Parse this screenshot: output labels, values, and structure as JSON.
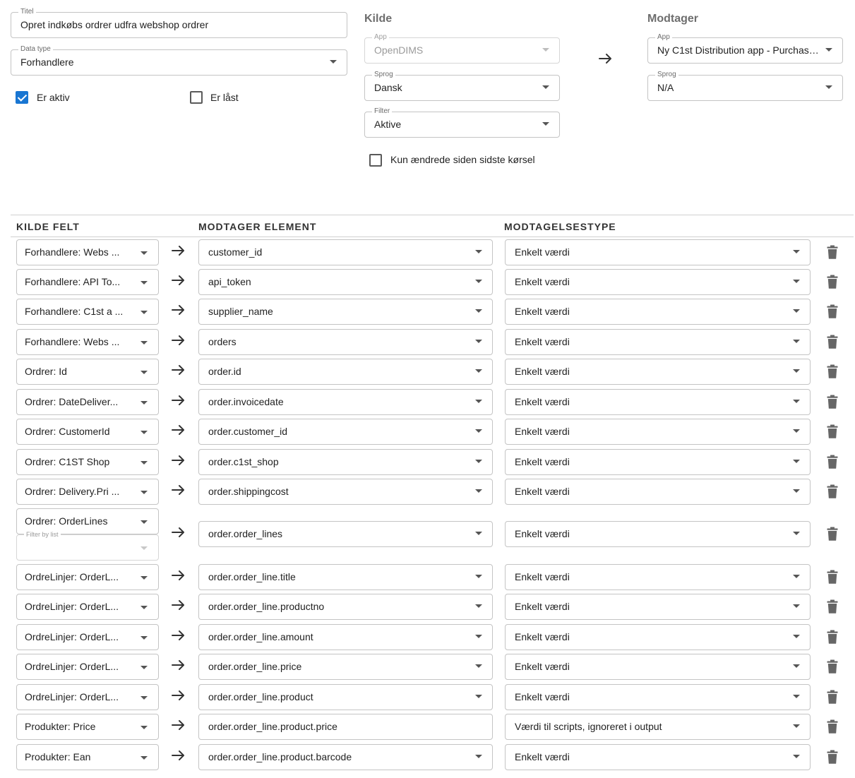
{
  "header": {
    "title_field": {
      "label": "Titel",
      "value": "Opret indkøbs ordrer udfra webshop ordrer"
    },
    "datatype_field": {
      "label": "Data type",
      "value": "Forhandlere"
    },
    "is_active": {
      "label": "Er aktiv",
      "checked": true
    },
    "is_locked": {
      "label": "Er låst",
      "checked": false
    }
  },
  "source": {
    "title": "Kilde",
    "app": {
      "label": "App",
      "value": "OpenDIMS"
    },
    "language": {
      "label": "Sprog",
      "value": "Dansk"
    },
    "filter": {
      "label": "Filter",
      "value": "Aktive"
    },
    "only_changed": {
      "label": "Kun ændrede siden sidste kørsel",
      "checked": false
    }
  },
  "receiver": {
    "title": "Modtager",
    "app": {
      "label": "App",
      "value": "Ny C1st Distribution app - Purchase O..."
    },
    "language": {
      "label": "Sprog",
      "value": "N/A"
    }
  },
  "table": {
    "headers": {
      "source": "KILDE FELT",
      "element": "MODTAGER ELEMENT",
      "type": "MODTAGELSESTYPE"
    },
    "filter_by_list_label": "Filter by list",
    "rows": [
      {
        "source": "Forhandlere: Webs ...",
        "element": "customer_id",
        "type": "Enkelt værdi"
      },
      {
        "source": "Forhandlere: API To...",
        "element": "api_token",
        "type": "Enkelt værdi"
      },
      {
        "source": "Forhandlere: C1st a ...",
        "element": "supplier_name",
        "type": "Enkelt værdi"
      },
      {
        "source": "Forhandlere: Webs ...",
        "element": "orders",
        "type": "Enkelt værdi"
      },
      {
        "source": "Ordrer: Id",
        "element": "order.id",
        "type": "Enkelt værdi"
      },
      {
        "source": "Ordrer: DateDeliver...",
        "element": "order.invoicedate",
        "type": "Enkelt værdi"
      },
      {
        "source": "Ordrer: CustomerId",
        "element": "order.customer_id",
        "type": "Enkelt værdi"
      },
      {
        "source": "Ordrer: C1ST Shop",
        "element": "order.c1st_shop",
        "type": "Enkelt værdi"
      },
      {
        "source": "Ordrer: Delivery.Pri ...",
        "element": "order.shippingcost",
        "type": "Enkelt værdi"
      },
      {
        "source": "Ordrer: OrderLines",
        "element": "order.order_lines",
        "type": "Enkelt værdi"
      },
      {
        "source": "OrdreLinjer: OrderL...",
        "element": "order.order_line.title",
        "type": "Enkelt værdi"
      },
      {
        "source": "OrdreLinjer: OrderL...",
        "element": "order.order_line.productno",
        "type": "Enkelt værdi"
      },
      {
        "source": "OrdreLinjer: OrderL...",
        "element": "order.order_line.amount",
        "type": "Enkelt værdi"
      },
      {
        "source": "OrdreLinjer: OrderL...",
        "element": "order.order_line.price",
        "type": "Enkelt værdi"
      },
      {
        "source": "OrdreLinjer: OrderL...",
        "element": "order.order_line.product",
        "type": "Enkelt værdi"
      },
      {
        "source": "Produkter: Price",
        "element": "order.order_line.product.price",
        "type": "Værdi til scripts, ignoreret i output"
      },
      {
        "source": "Produkter: Ean",
        "element": "order.order_line.product.barcode",
        "type": "Enkelt værdi"
      }
    ]
  }
}
